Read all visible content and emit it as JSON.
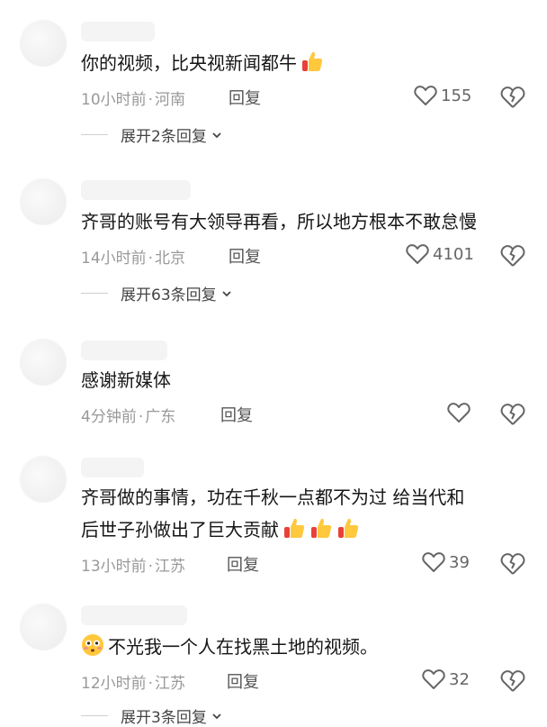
{
  "comments": [
    {
      "text": "你的视频，比央视新闻都牛",
      "emojis": [
        "thumbs-up-icon"
      ],
      "time": "10小时前",
      "location": "河南",
      "reply_label": "回复",
      "likes": "155",
      "expand_label": "展开2条回复"
    },
    {
      "text": "齐哥的账号有大领导再看，所以地方根本不敢怠慢",
      "emojis": [],
      "time": "14小时前",
      "location": "北京",
      "reply_label": "回复",
      "likes": "4101",
      "expand_label": "展开63条回复"
    },
    {
      "text": "感谢新媒体",
      "emojis": [],
      "time": "4分钟前",
      "location": "广东",
      "reply_label": "回复",
      "likes": "",
      "expand_label": ""
    },
    {
      "text_line1": "齐哥做的事情，功在千秋一点都不为过 给当代和",
      "text_line2": "后世子孙做出了巨大贡献",
      "emojis": [
        "thumbs-up-icon",
        "thumbs-up-icon",
        "thumbs-up-icon"
      ],
      "time": "13小时前",
      "location": "江苏",
      "reply_label": "回复",
      "likes": "39",
      "expand_label": ""
    },
    {
      "text": "不光我一个人在找黑土地的视频。",
      "emojis": [
        "flushed-face-icon"
      ],
      "time": "12小时前",
      "location": "江苏",
      "reply_label": "回复",
      "likes": "32",
      "expand_label": "展开3条回复"
    }
  ],
  "colors": {
    "meta_gray": "#999999",
    "text": "#161616",
    "emoji_yellow": "#FFC83D",
    "emoji_red": "#E8413A"
  }
}
